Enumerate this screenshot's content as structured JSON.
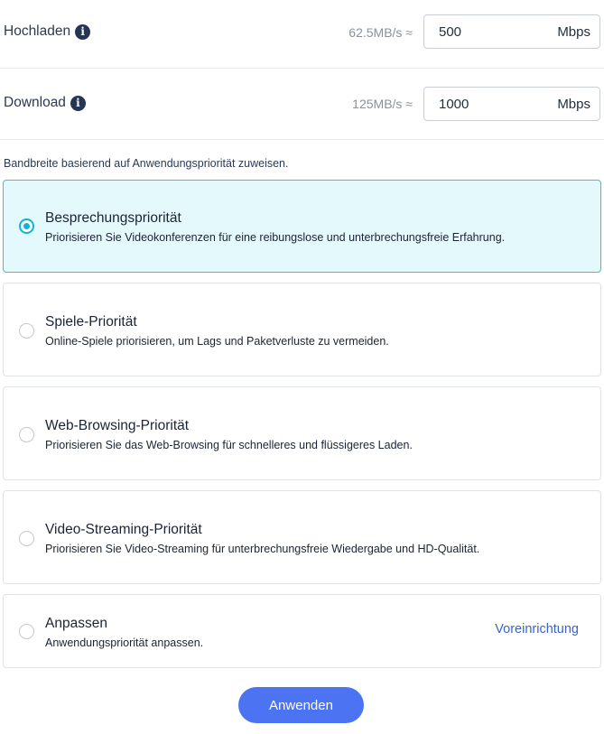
{
  "upload": {
    "label": "Hochladen",
    "info_icon": "info-icon",
    "rate": "62.5MB/s ≈",
    "value": "500",
    "unit": "Mbps"
  },
  "download": {
    "label": "Download",
    "info_icon": "info-icon",
    "rate": "125MB/s ≈",
    "value": "1000",
    "unit": "Mbps"
  },
  "hint": "Bandbreite basierend auf Anwendungspriorität zuweisen.",
  "options": [
    {
      "title": "Besprechungspriorität",
      "desc": "Priorisieren Sie Videokonferenzen für eine reibungslose und unterbrechungsfreie Erfahrung.",
      "selected": true
    },
    {
      "title": "Spiele-Priorität",
      "desc": "Online-Spiele priorisieren, um Lags und Paketverluste zu vermeiden.",
      "selected": false
    },
    {
      "title": "Web-Browsing-Priorität",
      "desc": "Priorisieren Sie das Web-Browsing für schnelleres und flüssigeres Laden.",
      "selected": false
    },
    {
      "title": "Video-Streaming-Priorität",
      "desc": "Priorisieren Sie Video-Streaming für unterbrechungsfreie Wiedergabe und HD-Qualität.",
      "selected": false
    },
    {
      "title": "Anpassen",
      "desc": "Anwendungspriorität anpassen.",
      "selected": false,
      "link": "Voreinrichtung"
    }
  ],
  "apply_label": "Anwenden",
  "colors": {
    "accent": "#0fb6cc",
    "selected_bg": "#e3f9fb",
    "button": "#4c73f1",
    "link": "#3a63c9"
  }
}
